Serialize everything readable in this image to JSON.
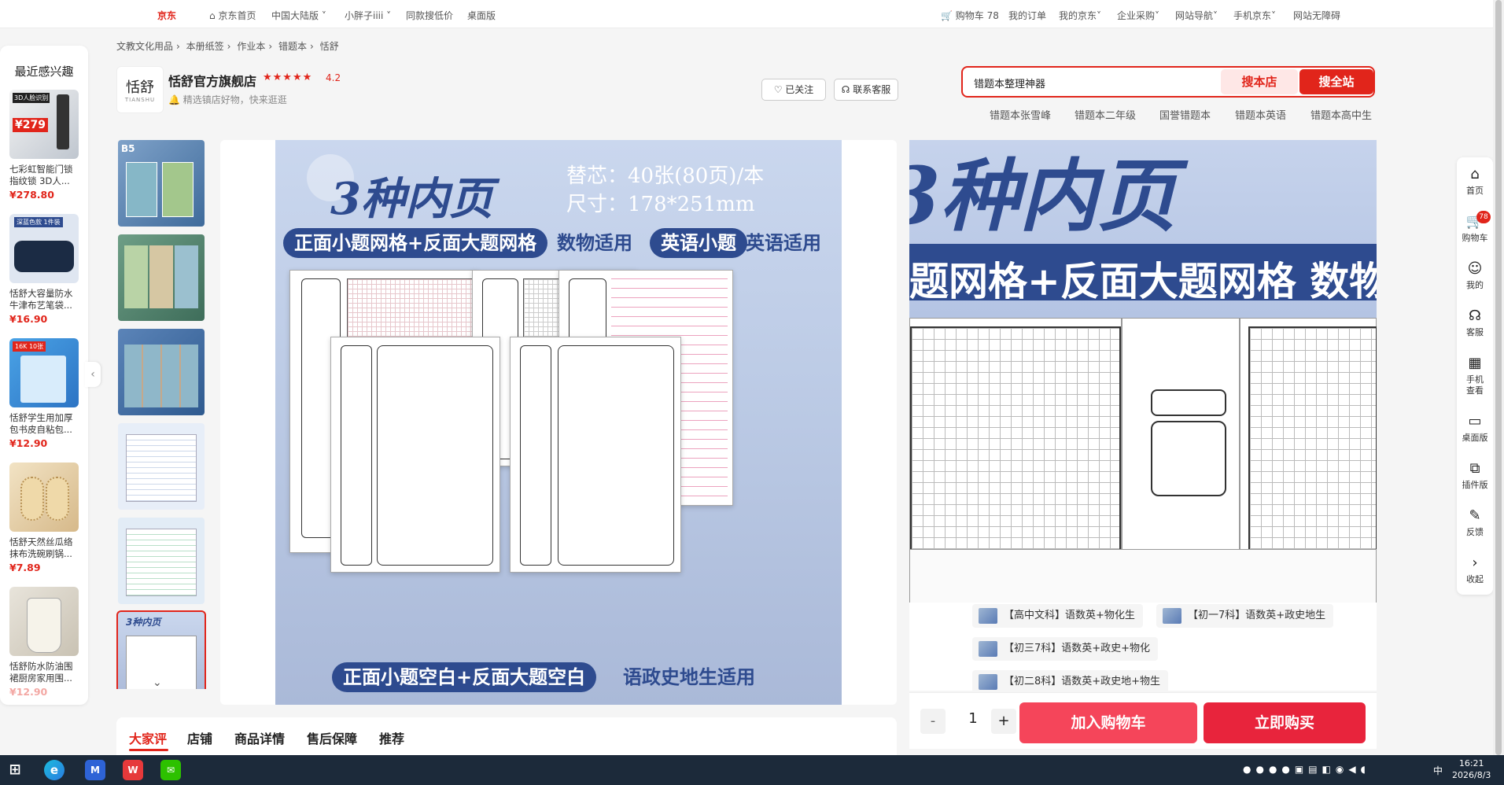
{
  "topbar": {
    "logo": "京东",
    "home": "京东首页",
    "region": "中国大陆版",
    "user": "小胖子iiii",
    "same_price": "同款搜低价",
    "desktop": "桌面版",
    "cart": "购物车 78",
    "orders": "我的订单",
    "my_jd": "我的京东",
    "enterprise": "企业采购",
    "site_nav": "网站导航",
    "mobile": "手机京东",
    "accessible": "网站无障碍"
  },
  "left_rail": {
    "title": "最近感兴趣",
    "items": [
      {
        "name": "七彩虹智能门锁指纹锁 3D人...",
        "price": "¥278.80",
        "tag": "3D人脸识别",
        "promo": "¥279"
      },
      {
        "name": "恬舒大容量防水牛津布艺笔袋...",
        "price": "¥16.90",
        "tag": "深蓝色款 1件装"
      },
      {
        "name": "恬舒学生用加厚包书皮自粘包...",
        "price": "¥12.90",
        "tag": "16K 10张"
      },
      {
        "name": "恬舒天然丝瓜络抹布洗碗刷锅...",
        "price": "¥7.89"
      },
      {
        "name": "恬舒防水防油围裙厨房家用围...",
        "price": "¥12.90"
      }
    ]
  },
  "breadcrumb": [
    "文教文化用品",
    "本册纸签",
    "作业本",
    "错题本",
    "恬舒"
  ],
  "shop": {
    "logo_text": "恬舒",
    "logo_sub": "TIANSHU",
    "name": "恬舒官方旗舰店",
    "stars": "★★★★★",
    "score": "4.2",
    "desc": "精选镇店好物，快来逛逛",
    "follow": "已关注",
    "service": "联系客服"
  },
  "search": {
    "query": "错题本整理神器",
    "btn_shop": "搜本店",
    "btn_all": "搜全站",
    "hot": [
      "错题本张雪峰",
      "错题本二年级",
      "国誉错题本",
      "错题本英语",
      "错题本高中生"
    ]
  },
  "poster": {
    "title": "3种内页",
    "spec1": "替芯：40张(80页)/本",
    "spec2": "尺寸：178*251mm",
    "pill1": "正面小题网格+反面大题网格",
    "pill1b": "数物适用",
    "pill2": "英语小题",
    "pill2b": "英语适用",
    "pill3": "正面小题空白+反面大题空白",
    "pill3b": "语政史地生适用"
  },
  "side_image": {
    "big": "3种内页",
    "band": "题网格+反面大题网格 数物"
  },
  "variants": [
    "【高中文科】语数英+物化生",
    "【初一7科】语数英+政史地生",
    "【初三7科】语数英+政史+物化",
    "【初二8科】语数英+政史地+物生"
  ],
  "buy": {
    "minus": "-",
    "qty": "1",
    "plus": "+",
    "add_cart": "加入购物车",
    "buy_now": "立即购买"
  },
  "tabs": [
    "大家评",
    "店铺",
    "商品详情",
    "售后保障",
    "推荐"
  ],
  "right_bar": [
    {
      "label": "首页",
      "icon": "home-icon"
    },
    {
      "label": "购物车",
      "icon": "cart-icon",
      "badge": "78"
    },
    {
      "label": "我的",
      "icon": "user-icon"
    },
    {
      "label": "客服",
      "icon": "headset-icon"
    },
    {
      "label": "手机查看",
      "icon": "qrcode-icon"
    },
    {
      "label": "桌面版",
      "icon": "monitor-icon"
    },
    {
      "label": "插件版",
      "icon": "plugin-icon"
    },
    {
      "label": "反馈",
      "icon": "feedback-icon"
    },
    {
      "label": "收起",
      "icon": "chevron-right-icon"
    }
  ],
  "taskbar": {
    "time": "16:21",
    "date": "2026/8/3",
    "ime": "中"
  }
}
